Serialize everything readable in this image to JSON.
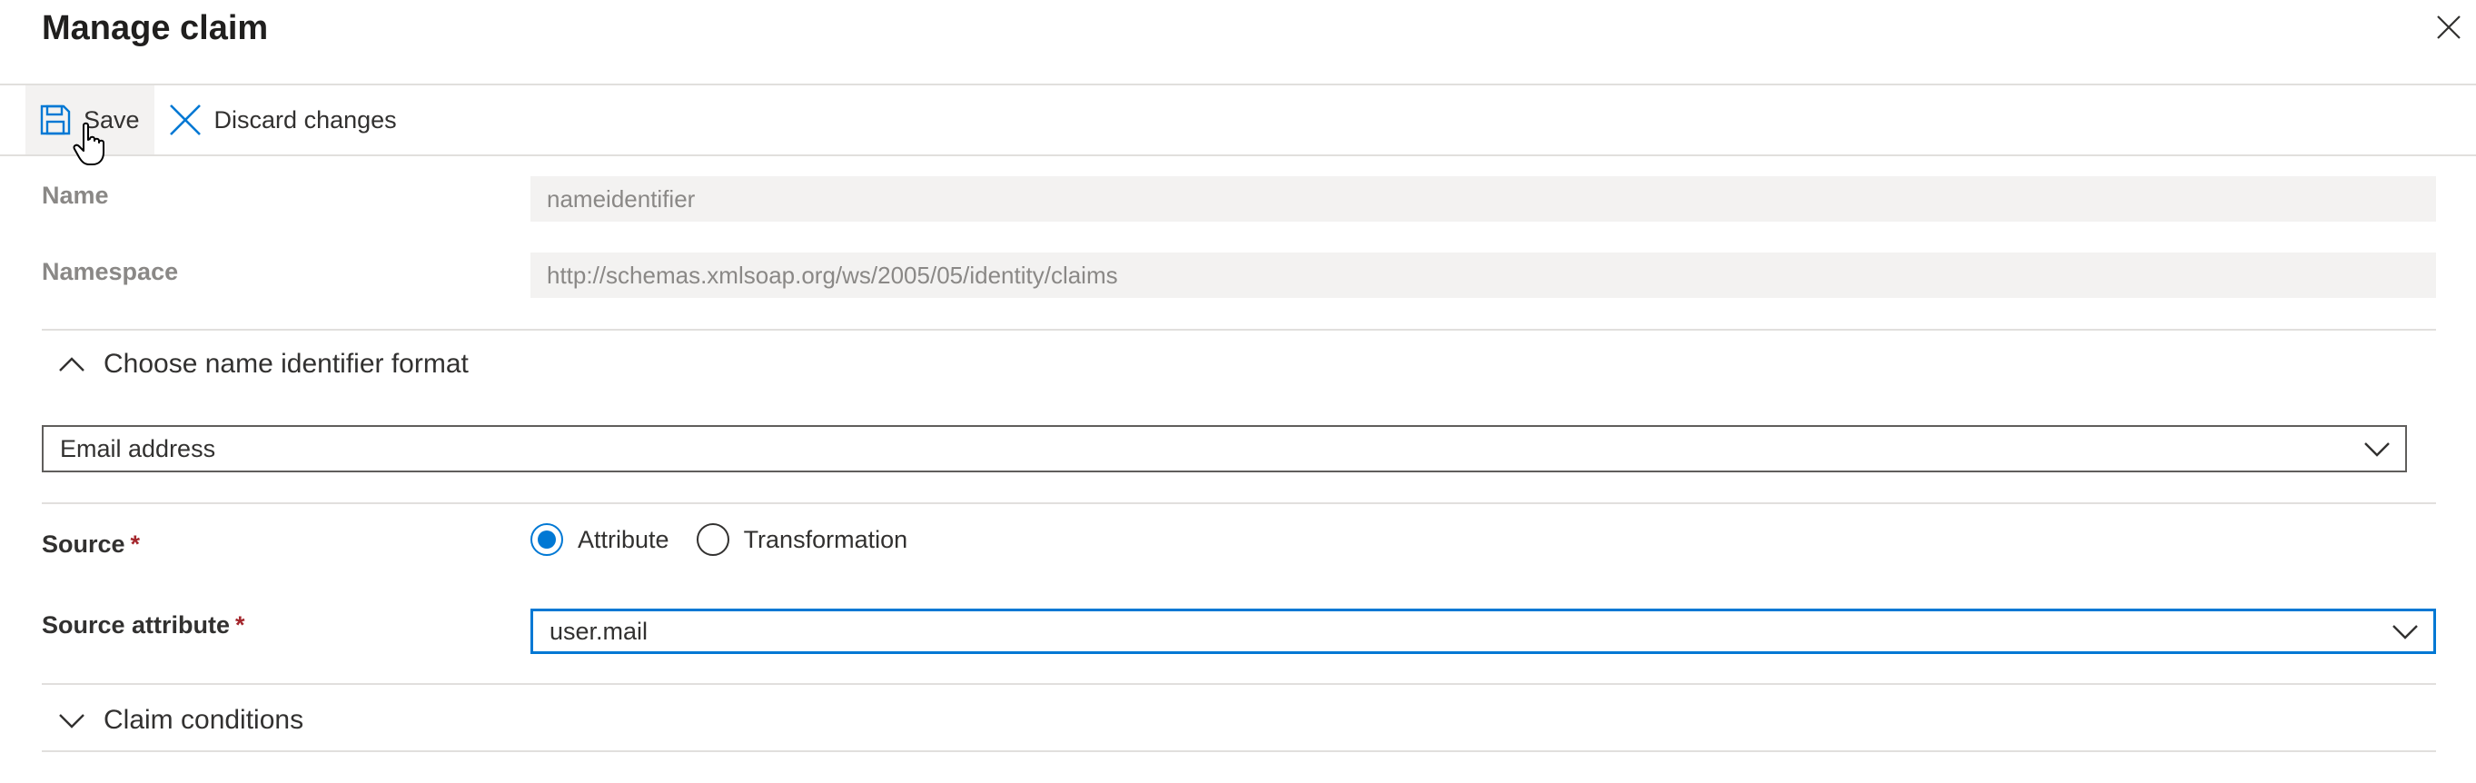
{
  "panel": {
    "title": "Manage claim",
    "close_icon": "close-icon"
  },
  "toolbar": {
    "save_label": "Save",
    "discard_label": "Discard changes"
  },
  "form": {
    "name_label": "Name",
    "name_value": "nameidentifier",
    "namespace_label": "Namespace",
    "namespace_value": "http://schemas.xmlsoap.org/ws/2005/05/identity/claims",
    "identifier_section": {
      "label": "Choose name identifier format",
      "expanded": true
    },
    "identifier_format_value": "Email address",
    "source_label": "Source",
    "source_required": "*",
    "source_options": [
      "Attribute",
      "Transformation"
    ],
    "source_selected": "Attribute",
    "source_attribute_label": "Source attribute",
    "source_attribute_required": "*",
    "source_attribute_value": "user.mail",
    "claim_conditions": {
      "label": "Claim conditions",
      "expanded": false
    }
  },
  "colors": {
    "accent": "#0078d4",
    "required": "#a4262c",
    "disabled_bg": "#f3f2f1",
    "disabled_text": "#8a8886"
  }
}
